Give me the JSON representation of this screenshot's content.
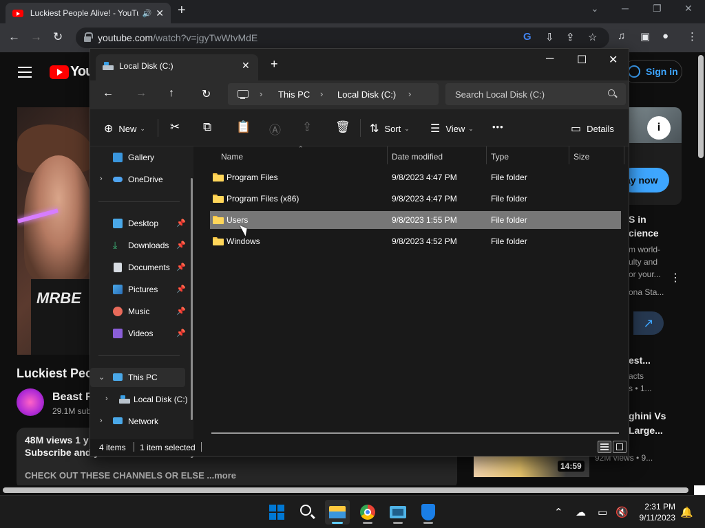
{
  "browser": {
    "tab_title": "Luckiest People Alive! - YouTube",
    "tab_audio_icon": "speaker-icon",
    "new_tab": "+",
    "url_domain": "youtube.com",
    "url_path": "/watch?v=jgyTwWtvMdE",
    "window_controls": {
      "minimize": "─",
      "restore": "❐",
      "close": "✕",
      "tab_search": "⌄"
    }
  },
  "youtube": {
    "logo_text": "You",
    "sign_in": "Sign in",
    "video_title": "Luckiest Peo",
    "shirt_logo": "MRBE",
    "channel_name": "Beast R",
    "subscribers": "29.1M sub",
    "views": "48M views  1 y",
    "description_line": "Subscribe and you will become lucky!",
    "description_more": "CHECK OUT THESE CHANNELS OR ELSE   ...more",
    "sidebar": {
      "ad_button": "ay now",
      "ad_info": "i",
      "card1_title": "S in",
      "card1_title2": "cience",
      "card1_lines": [
        "m world-",
        "ulty and",
        "or your...",
        "ona Sta..."
      ],
      "card2_title": "est...",
      "card2_meta": [
        "acts",
        "s • 1..."
      ],
      "card3_title": "ghini Vs",
      "card3_title2": "Large...",
      "card3_meta": "92M views • 9...",
      "duration": "14:59"
    }
  },
  "explorer": {
    "tab_title": "Local Disk (C:)",
    "tab_close": "✕",
    "new_tab": "+",
    "controls": {
      "minimize": "─",
      "maximize": "☐",
      "close": "✕"
    },
    "breadcrumbs": [
      "This PC",
      "Local Disk (C:)"
    ],
    "search_placeholder": "Search Local Disk (C:)",
    "toolbar": {
      "new_label": "New",
      "sort_label": "Sort",
      "view_label": "View",
      "more_label": "•••",
      "details_label": "Details"
    },
    "sidebar": {
      "items": [
        {
          "label": "Gallery"
        },
        {
          "label": "OneDrive"
        },
        {
          "label": "Desktop"
        },
        {
          "label": "Downloads"
        },
        {
          "label": "Documents"
        },
        {
          "label": "Pictures"
        },
        {
          "label": "Music"
        },
        {
          "label": "Videos"
        },
        {
          "label": "This PC"
        },
        {
          "label": "Local Disk (C:)"
        },
        {
          "label": "Network"
        }
      ]
    },
    "columns": [
      "Name",
      "Date modified",
      "Type",
      "Size"
    ],
    "files": [
      {
        "name": "Program Files",
        "date": "9/8/2023 4:47 PM",
        "type": "File folder"
      },
      {
        "name": "Program Files (x86)",
        "date": "9/8/2023 4:47 PM",
        "type": "File folder"
      },
      {
        "name": "Users",
        "date": "9/8/2023 1:55 PM",
        "type": "File folder"
      },
      {
        "name": "Windows",
        "date": "9/8/2023 4:52 PM",
        "type": "File folder"
      }
    ],
    "selected_file": "Users",
    "status": {
      "count": "4 items",
      "selection": "1 item selected"
    }
  },
  "taskbar": {
    "apps": [
      "start-icon",
      "search-icon",
      "file-explorer-icon",
      "chrome-icon",
      "app-icon",
      "windows-security-icon"
    ],
    "time": "2:31 PM",
    "date": "9/11/2023"
  }
}
